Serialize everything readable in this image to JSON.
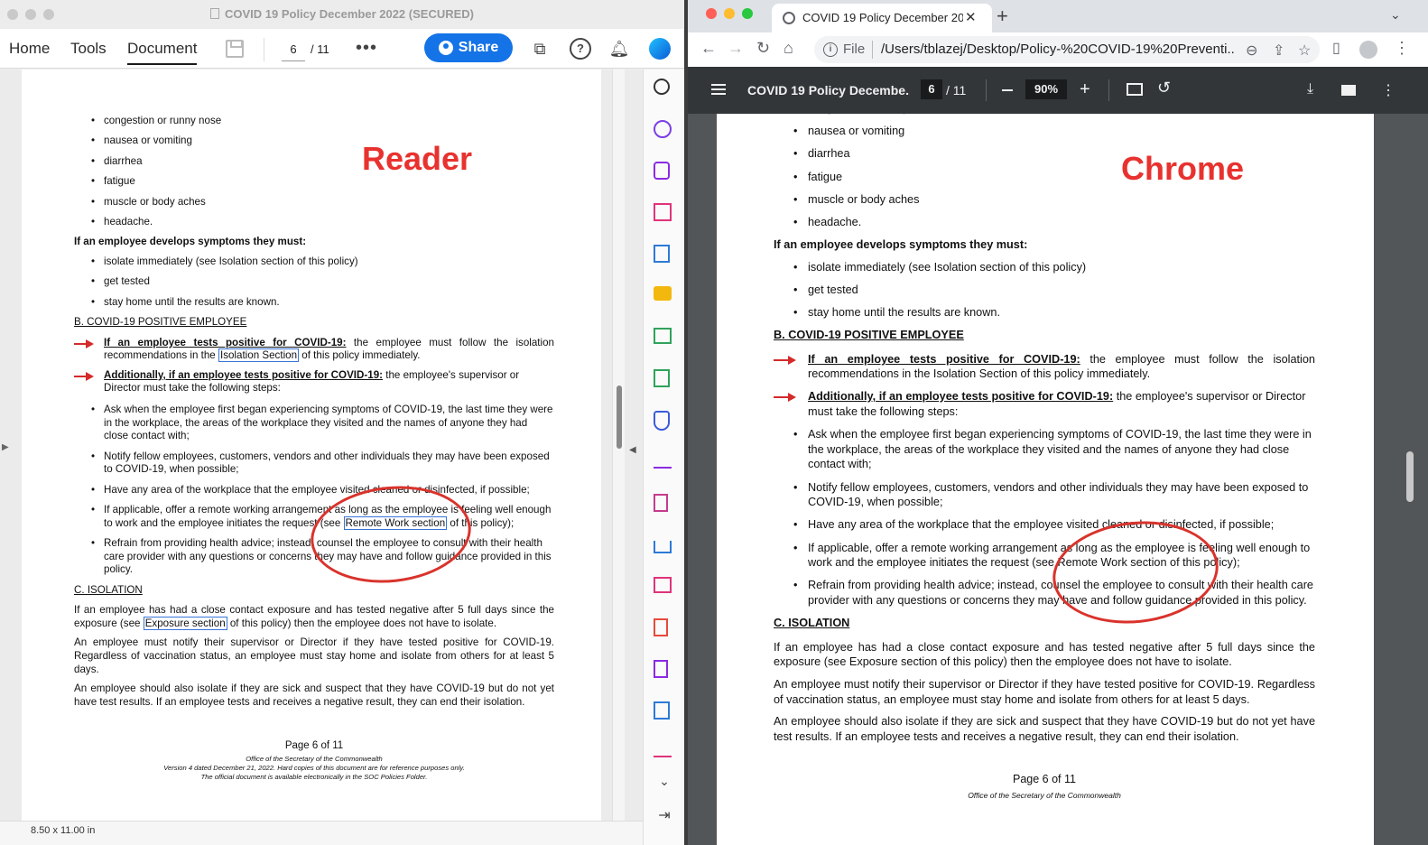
{
  "reader": {
    "window_title": "COVID 19 Policy December 2022 (SECURED)",
    "tabs": [
      "Home",
      "Tools",
      "Document"
    ],
    "active_tab": "Document",
    "page_current": "6",
    "page_total": "/ 11",
    "more_label": "•••",
    "share_label": "Share",
    "status_page_size": "8.50 x 11.00 in",
    "annotation_label": "Reader",
    "rail_icons": [
      "zoom-in-icon",
      "accessibility-icon",
      "fill-sign-icon",
      "organize-pages-icon",
      "export-pdf-icon",
      "comment-icon",
      "compare-icon",
      "compress-icon",
      "protect-icon",
      "sign-icon",
      "create-pdf-icon",
      "share-upload-icon",
      "redact-icon",
      "acrobat-pdf-icon",
      "edit-pdf-icon",
      "combine-icon",
      "fill-sign-pen-icon",
      "chevron-down-icon",
      "collapse-panel-icon"
    ]
  },
  "chrome": {
    "tab_title": "COVID 19 Policy December 20",
    "tab_close": "✕",
    "new_tab": "+",
    "url_scheme": "File",
    "url": "/Users/tblazej/Desktop/Policy-%20COVID-19%20Preventi...",
    "pdf_title": "COVID 19 Policy Decembe...",
    "page_current": "6",
    "page_total": "/ 11",
    "zoom": "90%",
    "annotation_label": "Chrome"
  },
  "document": {
    "symptoms_top": [
      "congestion or runny nose",
      "nausea or vomiting",
      "diarrhea",
      "fatigue",
      "muscle or body aches",
      "headache."
    ],
    "symptoms_intro": "If an employee develops symptoms they must:",
    "symptom_actions": [
      "isolate immediately (see Isolation section of this policy)",
      "get tested",
      "stay home until the results are known."
    ],
    "section_b": "B. COVID-19 POSITIVE EMPLOYEE",
    "b1_lead": "If an employee tests positive for COVID-19:",
    "b1_text_1": " the employee must follow the isolation recommendations in the ",
    "b1_link": "Isolation Section",
    "b1_text_2": " of this policy immediately.",
    "b1_text_plain": " the employee must follow the isolation recommendations in the Isolation Section of this policy immediately.",
    "b2_lead": "Additionally, if an employee tests positive for COVID-19:",
    "b2_text": " the employee's supervisor or Director must take the following steps:",
    "steps": [
      "Ask when the employee first began experiencing symptoms of COVID-19, the last time they were in the workplace, the areas of the workplace they visited and the names of anyone they had close contact with;",
      "Notify fellow employees, customers, vendors and other individuals they may have been exposed to COVID-19, when possible;",
      "Have any area of the workplace that the employee visited cleaned or disinfected, if possible;"
    ],
    "step4_text_1": "If applicable, offer a remote working arrangement as long as the employee is feeling well enough to work and the employee initiates the request (see ",
    "step4_link": "Remote Work section",
    "step4_text_2": " of this policy);",
    "step4_plain": "If applicable, offer a remote working arrangement as long as the employee is feeling well enough to work and the employee initiates the request (see Remote Work section of this policy);",
    "step5": "Refrain from providing health advice; instead, counsel the employee to consult with their health care provider with any questions or concerns they may have and follow guidance provided in this policy.",
    "section_c": "C. ISOLATION",
    "c1_text_1": "If an employee has had a close contact exposure and has tested negative after 5 full days since the exposure (see ",
    "c1_link": "Exposure section",
    "c1_text_2": " of this policy) then the employee does not have to isolate.",
    "c1_plain": "If an employee has had a close contact exposure and has tested negative after 5 full days since the exposure (see Exposure section of this policy) then the employee does not have to isolate.",
    "c2": "An employee must notify their supervisor or Director if they have tested positive for COVID-19. Regardless of vaccination status, an employee must stay home and isolate from others for at least 5 days.",
    "c3": "An employee should also isolate if they are sick and suspect that they have COVID-19 but do not yet have test results. If an employee tests and receives a negative result, they can end their isolation.",
    "footer_page": "Page 6 of 11",
    "footer_office": "Office of the Secretary of the Commonwealth",
    "footer_version": "Version 4 dated December 21, 2022. Hard copies of this document are for reference purposes only.",
    "footer_official": "The official document is available electronically in the SOC Policies Folder."
  },
  "colors": {
    "annotation_red": "#e8322f",
    "share_blue": "#1473e6",
    "link_box_blue": "#3874d8",
    "chrome_pdf_toolbar": "#323639"
  }
}
